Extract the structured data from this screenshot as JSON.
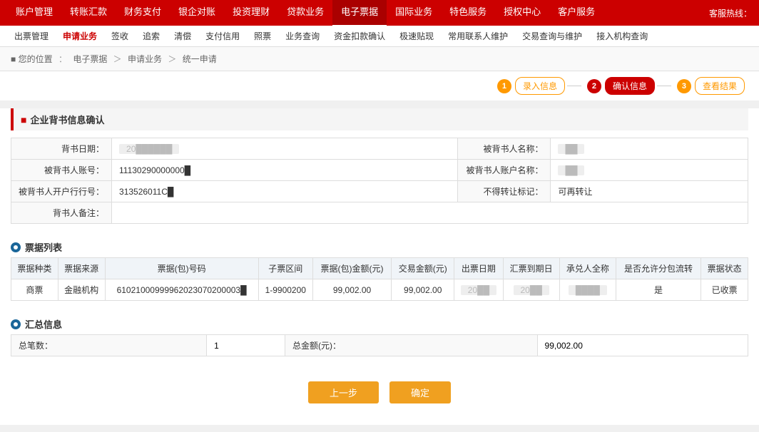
{
  "topService": "客服热线：",
  "topNav": [
    {
      "label": "账户管理",
      "active": false
    },
    {
      "label": "转账汇款",
      "active": false
    },
    {
      "label": "财务支付",
      "active": false
    },
    {
      "label": "银企对账",
      "active": false
    },
    {
      "label": "投资理财",
      "active": false
    },
    {
      "label": "贷款业务",
      "active": false
    },
    {
      "label": "电子票据",
      "active": true
    },
    {
      "label": "国际业务",
      "active": false
    },
    {
      "label": "特色服务",
      "active": false
    },
    {
      "label": "授权中心",
      "active": false
    },
    {
      "label": "客户服务",
      "active": false
    }
  ],
  "subNav": [
    {
      "label": "出票管理",
      "active": false
    },
    {
      "label": "申请业务",
      "active": true
    },
    {
      "label": "签收",
      "active": false
    },
    {
      "label": "追索",
      "active": false
    },
    {
      "label": "清偿",
      "active": false
    },
    {
      "label": "支付信用",
      "active": false
    },
    {
      "label": "照票",
      "active": false
    },
    {
      "label": "业务查询",
      "active": false
    },
    {
      "label": "资金扣款确认",
      "active": false
    },
    {
      "label": "极速贴现",
      "active": false
    },
    {
      "label": "常用联系人维护",
      "active": false
    },
    {
      "label": "交易查询与维护",
      "active": false
    },
    {
      "label": "接入机构查询",
      "active": false
    }
  ],
  "breadcrumb": {
    "root": "您的位置",
    "path": [
      "电子票据",
      "申请业务",
      "统一申请"
    ]
  },
  "steps": [
    {
      "number": "1",
      "label": "录入信息",
      "state": "done"
    },
    {
      "number": "2",
      "label": "确认信息",
      "state": "active"
    },
    {
      "number": "3",
      "label": "查看结果",
      "state": "todo"
    }
  ],
  "sectionTitle": "企业背书信息确认",
  "infoFields": {
    "endorseDate": {
      "label": "背书日期：",
      "value": "20██████"
    },
    "endorseeName": {
      "label": "被背书人名称：",
      "value": "██"
    },
    "endorseeAccount": {
      "label": "被背书人账号：",
      "value": "11130290000000█"
    },
    "endorseeAccountName": {
      "label": "被背书人账户名称：",
      "value": "██"
    },
    "endorseeBankCode": {
      "label": "被背书人开户行行号：",
      "value": "313526011C█"
    },
    "notTransferMark": {
      "label": "不得转让标记：",
      "value": "可再转让"
    },
    "remark": {
      "label": "背书人备注：",
      "value": ""
    }
  },
  "ticketSection": "票据列表",
  "ticketTableHeaders": [
    "票据种类",
    "票据来源",
    "票据(包)号码",
    "子票区间",
    "票据(包)金额(元)",
    "交易金额(元)",
    "出票日期",
    "汇票到期日",
    "承兑人全称",
    "是否允许分包流转",
    "票据状态"
  ],
  "ticketRows": [
    {
      "type": "商票",
      "source": "金融机构",
      "code": "61021000999962023070200003█",
      "subRange": "1-9900200",
      "amount": "99,002.00",
      "tradeAmount": "99,002.00",
      "issueDate": "20██",
      "dueDate": "20██",
      "acceptor": "████",
      "allowSplit": "是",
      "status": "已收票"
    }
  ],
  "summarySection": "汇总信息",
  "summaryFields": {
    "totalCount": {
      "label": "总笔数：",
      "value": "1"
    },
    "totalAmount": {
      "label": "总金额(元)：",
      "value": "99,002.00"
    }
  },
  "buttons": {
    "prev": "上一步",
    "confirm": "确定"
  }
}
